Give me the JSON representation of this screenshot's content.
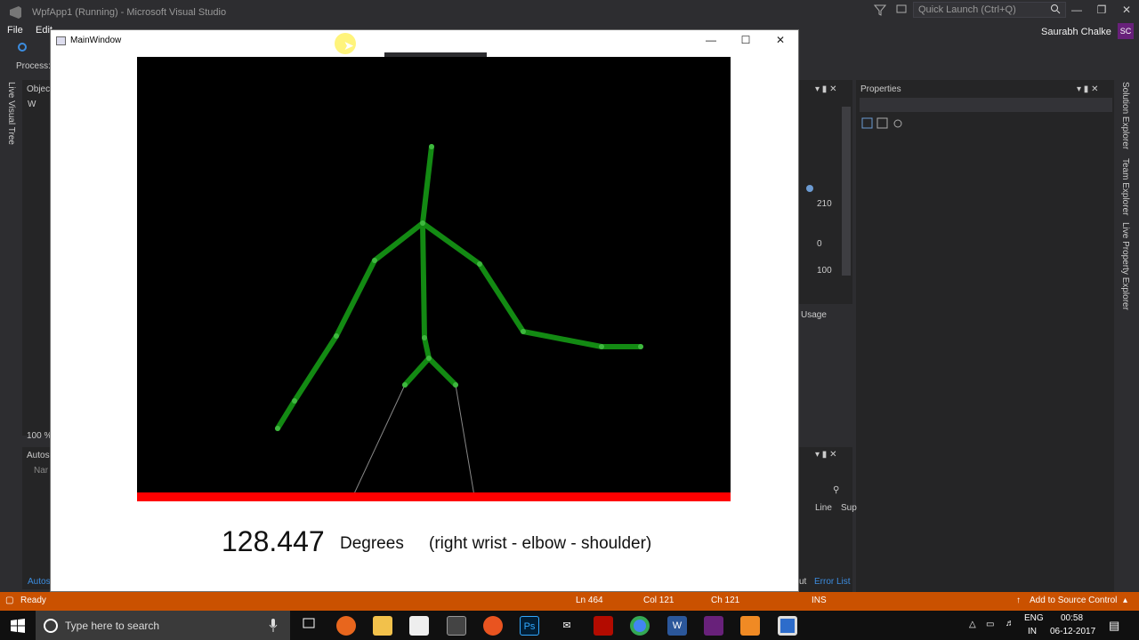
{
  "vs": {
    "title": "WpfApp1 (Running) - Microsoft Visual Studio",
    "quick_launch_placeholder": "Quick Launch (Ctrl+Q)",
    "menu": [
      "File",
      "Edit"
    ],
    "user": "Saurabh Chalke",
    "avatar": "SC",
    "process_label": "Process:",
    "live_visual_tree": "Live Visual Tree",
    "object_label": "Objec",
    "object_item": "W",
    "zoom": "100 %",
    "autos": "Autos",
    "autos_tab": "Autos",
    "name_col": "Nar",
    "properties_title": "Properties",
    "prop_values": [
      "210",
      "0",
      "100"
    ],
    "usage_label": "Usage",
    "line_col": "Line",
    "sup_col": "Sup",
    "error_list_tab": "Error List",
    "output_tab_fragment": "ut",
    "side_tabs": [
      "Solution Explorer",
      "Team Explorer",
      "Live Property Explorer"
    ]
  },
  "main_window": {
    "title": "MainWindow",
    "angle_value": "128.447",
    "angle_unit": "Degrees",
    "angle_description": "(right wrist - elbow - shoulder)",
    "skeleton_color": "#138a13",
    "floor_color": "#ff0000"
  },
  "statusbar": {
    "ready": "Ready",
    "ln": "Ln 464",
    "col": "Col 121",
    "ch": "Ch 121",
    "ins": "INS",
    "source_control": "Add to Source Control",
    "color": "#ca5100"
  },
  "taskbar": {
    "search_placeholder": "Type here to search",
    "lang_primary": "ENG",
    "lang_secondary": "IN",
    "time": "00:58",
    "date": "06-12-2017",
    "apps": [
      "task-view",
      "firefox",
      "file-explorer",
      "store",
      "calculator",
      "ubuntu",
      "photoshop",
      "mail",
      "acrobat",
      "chrome",
      "word",
      "visual-studio",
      "vlc",
      "running-app"
    ]
  }
}
